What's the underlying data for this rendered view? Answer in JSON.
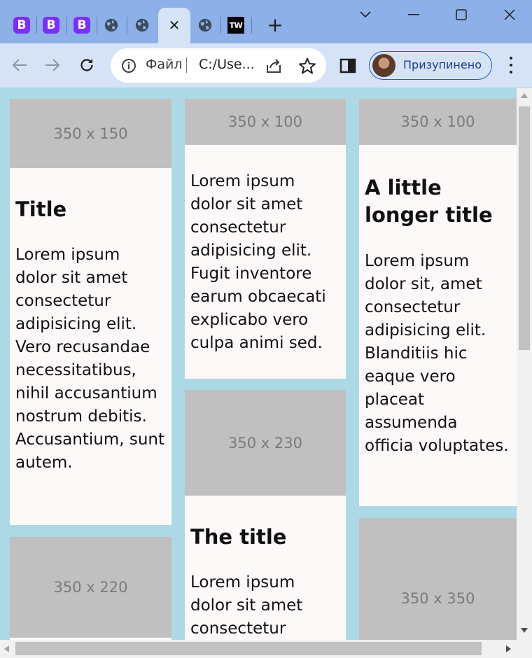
{
  "browser": {
    "tabs": [
      {
        "icon": "bootstrap-icon",
        "label": "B"
      },
      {
        "icon": "bootstrap-icon",
        "label": "B"
      },
      {
        "icon": "bootstrap-icon",
        "label": "B"
      },
      {
        "icon": "globe-icon"
      },
      {
        "icon": "globe-icon"
      },
      {
        "icon": "close-icon",
        "active": true
      },
      {
        "icon": "globe-icon"
      },
      {
        "icon": "tailwind-icon",
        "label": "TW"
      }
    ],
    "new_tab_label": "+",
    "close_glyph": "✕",
    "omnibox": {
      "label": "Файл",
      "url": "C:/Use..."
    },
    "profile": {
      "label": "Призупинено"
    },
    "colors": {
      "tabbar": "#8db0e8",
      "toolbar": "#d6e3f6",
      "profile_border": "#1e5cc8",
      "bootstrap": "#7b2ff7"
    }
  },
  "page": {
    "background": "#add8e6",
    "cards": [
      {
        "image_label": "350 x 150",
        "title": "Title",
        "text": "Lorem ipsum dolor sit amet consectetur adipisicing elit. Vero recusandae necessitatibus, nihil accusantium nostrum debitis. Accusantium, sunt autem."
      },
      {
        "image_label": "350 x 100",
        "text": "Lorem ipsum dolor sit amet consectetur adipisicing elit. Fugit inventore earum obcaecati explicabo vero culpa animi sed."
      },
      {
        "image_label": "350 x 100",
        "title": "A little longer title",
        "text": "Lorem ipsum dolor sit, amet consectetur adipisicing elit. Blanditiis hic eaque vero placeat assumenda officia voluptates."
      },
      {
        "image_label": "350 x 220"
      },
      {
        "image_label": "350 x 230",
        "title": "The title",
        "text": "Lorem ipsum dolor sit amet consectetur"
      },
      {
        "image_label": "350 x 350"
      }
    ]
  }
}
